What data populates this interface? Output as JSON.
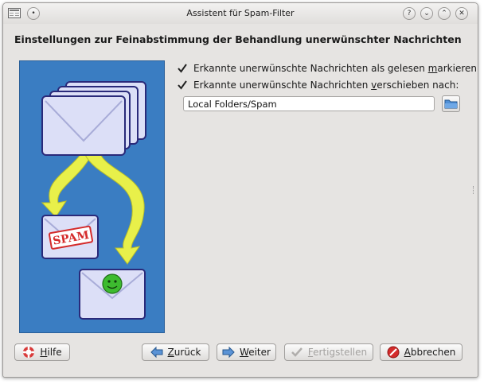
{
  "window": {
    "title": "Assistent für Spam-Filter"
  },
  "heading": "Einstellungen zur Feinabstimmung der Behandlung unerwünschter Nachrichten",
  "illustration": {
    "stamp_text": "SPAM"
  },
  "options": [
    {
      "pre": "Erkannte unerwünschte Nachrichten als gelesen ",
      "accel": "m",
      "post": "arkieren",
      "checked": true
    },
    {
      "pre": "Erkannte unerwünschte Nachrichten ",
      "accel": "v",
      "post": "erschieben nach:",
      "checked": true
    }
  ],
  "target_folder": "Local Folders/Spam",
  "buttons": {
    "help": {
      "accel": "H",
      "rest": "ilfe"
    },
    "back": {
      "accel": "Z",
      "rest": "urück"
    },
    "next": {
      "accel": "W",
      "rest": "eiter"
    },
    "finish": {
      "accel": "F",
      "rest": "ertigstellen",
      "enabled": false
    },
    "cancel": {
      "accel": "A",
      "rest": "bbrechen"
    }
  },
  "colors": {
    "art_background": "#3a7dc2",
    "arrow": "#e8f04a",
    "envelope": "#dcdff7",
    "smiley": "#3dbb2f",
    "stamp": "#d42b2b"
  }
}
